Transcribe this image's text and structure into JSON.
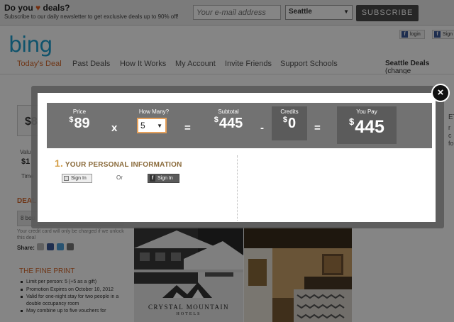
{
  "topbar": {
    "promo_title_prefix": "Do you",
    "promo_title_suffix": "deals?",
    "heart": "♥",
    "promo_subtitle": "Subscribe to our daily newsletter to get exclusive deals up to 90% off!",
    "email_placeholder": "Your e-mail address",
    "city_value": "Seattle",
    "subscribe_label": "SUBSCRIBE"
  },
  "header": {
    "logo": "bing",
    "fb_login_label": "login",
    "fb_signup_label": "Sign",
    "nav_items": [
      "Today's Deal",
      "Past Deals",
      "How It Works",
      "My Account",
      "Invite Friends",
      "Support Schools"
    ],
    "city_deals_label": "Seattle Deals",
    "city_deals_change": "(change"
  },
  "background": {
    "price_stub": "$8",
    "value_stub": "Valu",
    "value_num": "$1",
    "time_stub": "Time",
    "deal_stub": "DEAL",
    "bought_text": "8 bou",
    "charge_note": "Your credit card will only be charged if we unlock this deal",
    "share_label": "Share:",
    "fine_print_title": "THE FINE PRINT",
    "fine_print_items": [
      "Limit per person: 5 (+5 as a gift)",
      "Promotion Expires on October 10, 2012",
      "Valid for one-night stay for two people in a double occupancy room",
      "May combine up to five vouchers for"
    ],
    "right_stub1": "ET",
    "right_stub2": "r\nc\nfo"
  },
  "photo": {
    "hotel_name": "CRYSTAL MOUNTAIN",
    "hotel_sub": "HOTELS"
  },
  "modal": {
    "price_label": "Price",
    "price_value": "89",
    "times": "x",
    "qty_label": "How Many?",
    "qty_value": "5",
    "equals": "=",
    "subtotal_label": "Subtotal",
    "subtotal_value": "445",
    "minus": "-",
    "credits_label": "Credits",
    "credits_value": "0",
    "pay_label": "You Pay",
    "pay_value": "445",
    "currency": "$",
    "close_glyph": "×",
    "info_num": "1.",
    "info_title": "YOUR PERSONAL INFORMATION",
    "signin_label": "Sign In",
    "or_text": "Or",
    "fb_signin_label": "Sign In",
    "fb_glyph": "f"
  },
  "colors": {
    "accent": "#d5692d",
    "bing_blue": "#1e9fcf",
    "modal_bar": "#727272"
  }
}
